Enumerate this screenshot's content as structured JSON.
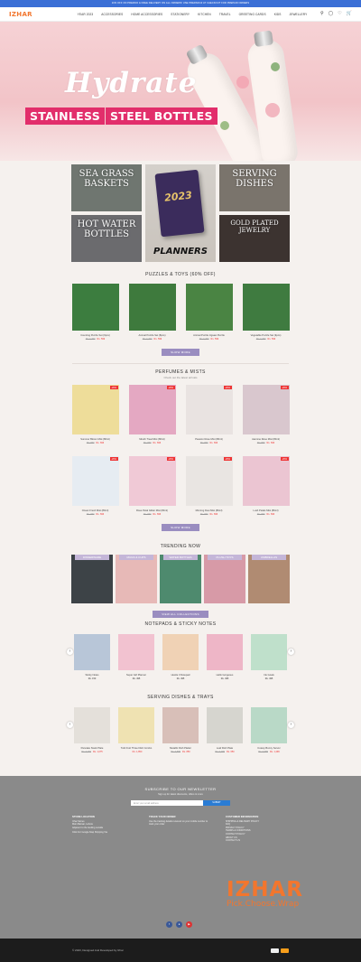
{
  "topbar": {
    "text": "10% OFF ON PREPAID & FREE DELIVERY ON ALL ORDERS! USE PREPAID10 AT CHECKOUT FOR PREPAID ORDERS"
  },
  "header": {
    "logo": "IZHAR",
    "nav": [
      "YEAR 2023",
      "ACCESSORIES",
      "HOME ACCESSORIES",
      "STATIONERY",
      "KITCHEN",
      "TRAVEL",
      "GREETING CARDS",
      "KIDS",
      "JEWELLERY"
    ],
    "icons": [
      "search-icon",
      "user-icon",
      "heart-icon",
      "cart-icon"
    ]
  },
  "hero": {
    "title": "Hydrate",
    "banner_left": "STAINLESS",
    "banner_right": "STEEL BOTTLES",
    "slides": 5,
    "active_slide": 1
  },
  "categories": [
    {
      "label": "SEA GRASS BASKETS",
      "color": "#6f7670"
    },
    {
      "label": "PLANNERS",
      "color": "#ccc6bf"
    },
    {
      "label": "SERVING DISHES",
      "color": "#7a746c"
    },
    {
      "label": "HOT WATER BOTTLES",
      "color": "#6b6b6e"
    },
    {
      "label": "GOLD PLATED JEWELRY",
      "color": "#3c3330"
    }
  ],
  "puzzles": {
    "title": "PUZZLES & TOYS (60% OFF)",
    "button": "SHOW MORE",
    "products": [
      {
        "name": "Counting Puzzle Set (6pcs)",
        "old": "Rs. 1,300",
        "new": "Rs. 599",
        "color": "#3c7d3f"
      },
      {
        "name": "Animal Puzzle Set (8pcs)",
        "old": "Rs. 1,300",
        "new": "Rs. 599",
        "color": "#3e7a3d"
      },
      {
        "name": "Animal Puzzle Jigsaw Puzzle",
        "old": "Rs. 1,300",
        "new": "Rs. 599",
        "color": "#4a8443"
      },
      {
        "name": "Vegetable Puzzle Set (9pcs)",
        "old": "Rs. 1,300",
        "new": "Rs. 599",
        "color": "#3f7b40"
      }
    ]
  },
  "perfumes": {
    "title": "PERFUMES & MISTS",
    "subtitle": "Check out the latest arrivals",
    "button": "SHOW MORE",
    "badge": "-20%",
    "products": [
      {
        "name": "Summer Bloom Mist (80ml)",
        "old": "Rs. 870",
        "new": "Rs. 696",
        "color": "#eedd9a"
      },
      {
        "name": "Mouth Treat Mist (80ml)",
        "old": "Rs. 870",
        "new": "Rs. 696",
        "color": "#e4a8c2"
      },
      {
        "name": "Passion Rose Mist (80ml)",
        "old": "Rs. 870",
        "new": "Rs. 696",
        "color": "#e9e3e1"
      },
      {
        "name": "Jasmine Rose Mist (80ml)",
        "old": "Rs. 870",
        "new": "Rs. 696",
        "color": "#d9c7ce"
      },
      {
        "name": "Ocean Fresh Mist (80ml)",
        "old": "Rs. 870",
        "new": "Rs. 696",
        "color": "#e6ecf2"
      },
      {
        "name": "Rose Petal Glitter Mist (80ml)",
        "old": "Rs. 870",
        "new": "Rs. 696",
        "color": "#f0c9d6"
      },
      {
        "name": "Morning Dew Mist (80ml)",
        "old": "Rs. 870",
        "new": "Rs. 696",
        "color": "#e9e5e2"
      },
      {
        "name": "Lush Petals Mist (80ml)",
        "old": "Rs. 870",
        "new": "Rs. 696",
        "color": "#ebc5d2"
      }
    ]
  },
  "trending": {
    "title": "TRENDING NOW",
    "button": "VIEW ALL COLLECTIONS",
    "items": [
      {
        "label": "DINNERWARE",
        "color": "#3d4347"
      },
      {
        "label": "MUGS & CUPS",
        "color": "#e7b9b7"
      },
      {
        "label": "WATER BOTTLES",
        "color": "#4e8a6e"
      },
      {
        "label": "PLUSH TOYS",
        "color": "#d79aa7"
      },
      {
        "label": "UMBRELLAS",
        "color": "#b08b72"
      }
    ]
  },
  "notepads": {
    "title": "NOTEPADS & STICKY NOTES",
    "products": [
      {
        "name": "Sticky Notes",
        "price": "Rs. 150",
        "color": "#b8c6d8"
      },
      {
        "name": "Super Girl Planner",
        "price": "Rs. 495",
        "color": "#f2c2d0"
      },
      {
        "name": "Hustle It Notepad",
        "price": "Rs. 495",
        "color": "#f0d2b5"
      },
      {
        "name": "Hello Gorgeous",
        "price": "Rs. 495",
        "color": "#eeb6c7"
      },
      {
        "name": "Ink Goals",
        "price": "Rs. 495",
        "color": "#bfe0cb"
      }
    ]
  },
  "dishes": {
    "title": "SERVING DISHES & TRAYS",
    "products": [
      {
        "name": "Pancake Stack Plate",
        "old": "Rs. 2,150",
        "new": "Rs. 1,075",
        "color": "#e4e0da"
      },
      {
        "name": "Tutti Fruit Three Dish Combo",
        "old": "",
        "new": "Rs. 1,850",
        "color": "#efe2b2"
      },
      {
        "name": "Metallic Dish Platter",
        "old": "Rs. 1,699",
        "new": "Rs. 850",
        "color": "#d8bfb8"
      },
      {
        "name": "Leaf Dish Plate",
        "old": "Rs. 1,299",
        "new": "Rs. 650",
        "color": "#d6d5cf"
      },
      {
        "name": "Cutesy Bunny Server",
        "old": "Rs. 2,999",
        "new": "Rs. 1,499",
        "color": "#b9d9c7"
      }
    ]
  },
  "footer": {
    "newsletter_title": "SUBSCRIBE TO OUR NEWSLETTER",
    "newsletter_sub": "Sign up for latest discounts, offers & more",
    "email_placeholder": "Enter your email address",
    "subscribe": "SUBMIT",
    "col1_title": "STORE LOCATION",
    "col1_lines": [
      "Izhar Stores",
      "Main Bazaar, Lahore",
      "Adjacent to the landing outside",
      "Click For Google Map Shipping Via"
    ],
    "col2_title": "TRACK YOUR ORDER",
    "col2_lines": [
      "Use the tracking details received on your mobile number to track your order"
    ],
    "col3_title": "CUSTOMER INFORMATION",
    "col3_lines": [
      "SHIPPING & DELIVERY POLICY",
      "FAQ",
      "PRIVACY POLICY",
      "TERMS & CONDITIONS",
      "CONTACT POLICY",
      "ABOUT US",
      "CONTACT US"
    ],
    "brand": "IZHAR",
    "tagline": "Pick.Choose.Wrap",
    "social": [
      "facebook-icon",
      "instagram-icon",
      "youtube-icon"
    ],
    "copyright": "© 2023, Designed And Developed by Izhar"
  }
}
